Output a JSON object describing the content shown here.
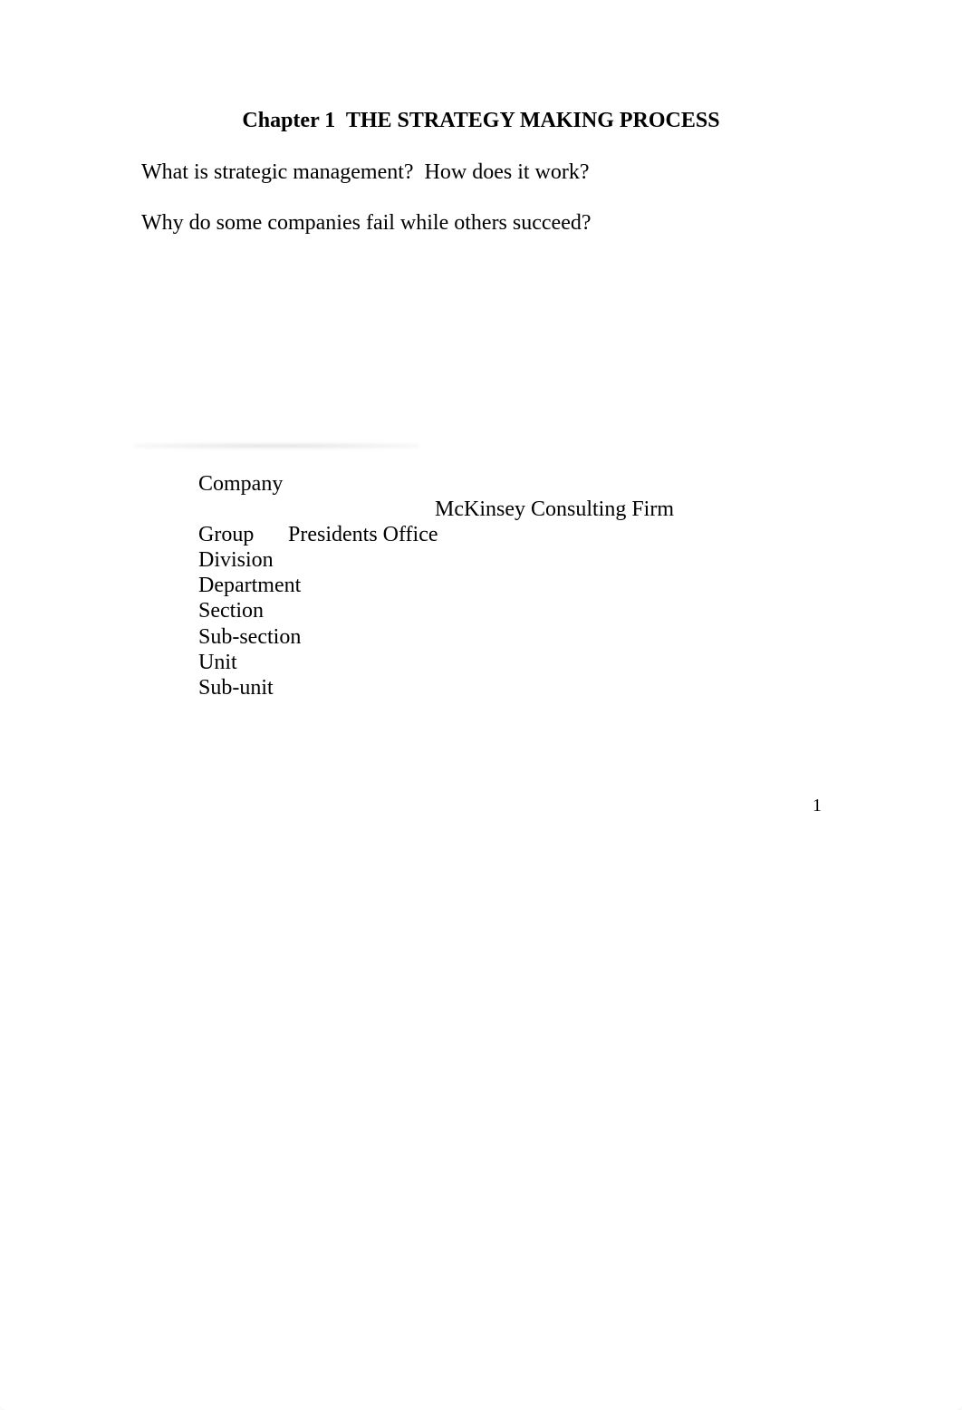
{
  "document": {
    "title": "Chapter 1  THE STRATEGY MAKING PROCESS",
    "questions": [
      "What is strategic management?  How does it work?",
      "Why do some companies fail while others succeed?"
    ],
    "hierarchy": {
      "top": "Company",
      "sub_item": "Presidents Office",
      "side_note": "McKinsey Consulting Firm",
      "levels": [
        "Group",
        "Division",
        "Department",
        "Section",
        "Sub-section",
        "Unit",
        "Sub-unit"
      ]
    },
    "page_number": "1"
  }
}
